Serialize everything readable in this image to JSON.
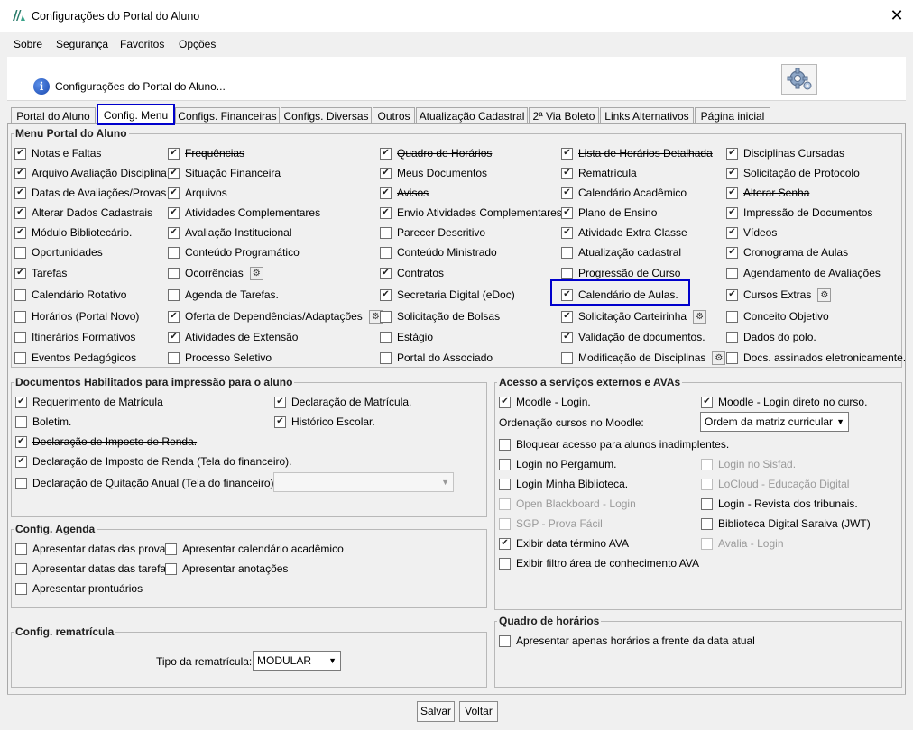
{
  "window": {
    "title": "Configurações do Portal do Aluno"
  },
  "menubar": [
    "Sobre",
    "Segurança",
    "Favoritos",
    "Opções"
  ],
  "header": {
    "text": "Configurações do Portal do Aluno..."
  },
  "tabs": [
    "Portal do Aluno",
    "Config. Menu",
    "Configs. Financeiras",
    "Configs. Diversas",
    "Outros",
    "Atualização Cadastral",
    "2ª Via Boleto",
    "Links Alternativos",
    "Página inicial"
  ],
  "active_tab": "Config. Menu",
  "menu_group": {
    "title": "Menu Portal do Aluno",
    "columns": [
      [
        {
          "label": "Notas e Faltas",
          "checked": true
        },
        {
          "label": "Arquivo Avaliação Disciplina",
          "checked": true
        },
        {
          "label": "Datas de Avaliações/Provas",
          "checked": true
        },
        {
          "label": "Alterar Dados Cadastrais",
          "checked": true
        },
        {
          "label": "Módulo Bibliotecário.",
          "checked": true
        },
        {
          "label": "Oportunidades",
          "checked": false
        },
        {
          "label": "Tarefas",
          "checked": true
        },
        {
          "label": "Calendário Rotativo",
          "checked": false
        },
        {
          "label": "Horários (Portal Novo)",
          "checked": false
        },
        {
          "label": "Itinerários Formativos",
          "checked": false
        },
        {
          "label": "Eventos Pedagógicos",
          "checked": false
        }
      ],
      [
        {
          "label": "Frequências",
          "checked": true,
          "strike": true
        },
        {
          "label": "Situação Financeira",
          "checked": true
        },
        {
          "label": "Arquivos",
          "checked": true
        },
        {
          "label": "Atividades Complementares",
          "checked": true
        },
        {
          "label": "Avaliação Institucional",
          "checked": true,
          "strike": true
        },
        {
          "label": "Conteúdo Programático",
          "checked": false
        },
        {
          "label": "Ocorrências",
          "checked": false,
          "gear": true
        },
        {
          "label": "Agenda de Tarefas.",
          "checked": false
        },
        {
          "label": "Oferta de Dependências/Adaptações",
          "checked": true,
          "gear": true
        },
        {
          "label": "Atividades de Extensão",
          "checked": true
        },
        {
          "label": "Processo Seletivo",
          "checked": false
        }
      ],
      [
        {
          "label": "Quadro de Horários",
          "checked": true,
          "strike": true
        },
        {
          "label": "Meus Documentos",
          "checked": true
        },
        {
          "label": "Avisos",
          "checked": true,
          "strike": true
        },
        {
          "label": "Envio Atividades Complementares",
          "checked": true
        },
        {
          "label": "Parecer Descritivo",
          "checked": false
        },
        {
          "label": "Conteúdo Ministrado",
          "checked": false
        },
        {
          "label": "Contratos",
          "checked": true
        },
        {
          "label": "Secretaria Digital (eDoc)",
          "checked": true
        },
        {
          "label": "Solicitação de Bolsas",
          "checked": false
        },
        {
          "label": "Estágio",
          "checked": false
        },
        {
          "label": "Portal do Associado",
          "checked": false
        }
      ],
      [
        {
          "label": "Lista de Horários Detalhada",
          "checked": true,
          "strike": true
        },
        {
          "label": "Rematrícula",
          "checked": true
        },
        {
          "label": "Calendário Acadêmico",
          "checked": true
        },
        {
          "label": "Plano de Ensino",
          "checked": true
        },
        {
          "label": "Atividade Extra Classe",
          "checked": true
        },
        {
          "label": "Atualização cadastral",
          "checked": false
        },
        {
          "label": "Progressão de Curso",
          "checked": false
        },
        {
          "label": "Calendário de Aulas.",
          "checked": true
        },
        {
          "label": "Solicitação Carteirinha",
          "checked": true,
          "gear": true
        },
        {
          "label": "Validação de documentos.",
          "checked": true
        },
        {
          "label": "Modificação de Disciplinas",
          "checked": false,
          "gear": true
        }
      ],
      [
        {
          "label": "Disciplinas Cursadas",
          "checked": true
        },
        {
          "label": "Solicitação de Protocolo",
          "checked": true
        },
        {
          "label": "Alterar Senha",
          "checked": true,
          "strike": true
        },
        {
          "label": "Impressão de Documentos",
          "checked": true
        },
        {
          "label": "Vídeos",
          "checked": true,
          "strike": true
        },
        {
          "label": "Cronograma de Aulas",
          "checked": true
        },
        {
          "label": "Agendamento de Avaliações",
          "checked": false
        },
        {
          "label": "Cursos Extras",
          "checked": true,
          "gear": true
        },
        {
          "label": "Conceito Objetivo",
          "checked": false
        },
        {
          "label": "Dados do polo.",
          "checked": false
        },
        {
          "label": "Docs. assinados eletronicamente.",
          "checked": false
        }
      ]
    ]
  },
  "docs_group": {
    "title": "Documentos Habilitados para impressão para o aluno",
    "items": [
      {
        "label": "Requerimento de Matrícula",
        "checked": true
      },
      {
        "label": "Declaração de Matrícula.",
        "checked": true
      },
      {
        "label": "Boletim.",
        "checked": false
      },
      {
        "label": "Histórico Escolar.",
        "checked": true
      },
      {
        "label": "Declaração de Imposto de Renda.",
        "checked": true,
        "strike": true
      },
      {
        "label": "Declaração de Imposto de Renda (Tela do financeiro).",
        "checked": true
      },
      {
        "label": "Declaração de Quitação Anual (Tela do financeiro).",
        "checked": false
      }
    ],
    "quitacao_combo": ""
  },
  "agenda_group": {
    "title": "Config. Agenda",
    "items": [
      {
        "label": "Apresentar datas das provas",
        "checked": false
      },
      {
        "label": "Apresentar calendário acadêmico",
        "checked": false
      },
      {
        "label": "Apresentar datas das tarefas",
        "checked": false
      },
      {
        "label": "Apresentar anotações",
        "checked": false
      },
      {
        "label": "Apresentar prontuários",
        "checked": false
      }
    ]
  },
  "remat_group": {
    "title": "Config. rematrícula",
    "tipo_label": "Tipo da rematrícula:",
    "tipo_value": "MODULAR"
  },
  "avas_group": {
    "title": "Acesso a serviços externos e AVAs",
    "moodle_login": {
      "label": "Moodle - Login.",
      "checked": true
    },
    "moodle_direct": {
      "label": "Moodle - Login direto no curso.",
      "checked": true
    },
    "ordenacao_label": "Ordenação cursos no Moodle:",
    "ordenacao_value": "Ordem da matriz curricular",
    "items": [
      {
        "label": "Bloquear acesso para alunos inadimplentes.",
        "checked": false
      },
      {
        "label": "Login no Pergamum.",
        "checked": false
      },
      {
        "label": "Login no Sisfad.",
        "checked": false,
        "disabled": true
      },
      {
        "label": "Login Minha Biblioteca.",
        "checked": false
      },
      {
        "label": "LoCloud - Educação Digital",
        "checked": false,
        "disabled": true
      },
      {
        "label": "Open Blackboard - Login",
        "checked": false,
        "disabled": true
      },
      {
        "label": "Login - Revista dos tribunais.",
        "checked": false
      },
      {
        "label": "SGP - Prova Fácil",
        "checked": false,
        "disabled": true
      },
      {
        "label": "Biblioteca Digital Saraiva (JWT)",
        "checked": false
      },
      {
        "label": "Exibir data término AVA",
        "checked": true
      },
      {
        "label": "Avalia - Login",
        "checked": false,
        "disabled": true
      },
      {
        "label": "Exibir filtro área de conhecimento AVA",
        "checked": false
      }
    ]
  },
  "quadro_group": {
    "title": "Quadro de horários",
    "item": {
      "label": "Apresentar apenas horários a frente da data atual",
      "checked": false
    }
  },
  "buttons": {
    "save": "Salvar",
    "back": "Voltar"
  }
}
